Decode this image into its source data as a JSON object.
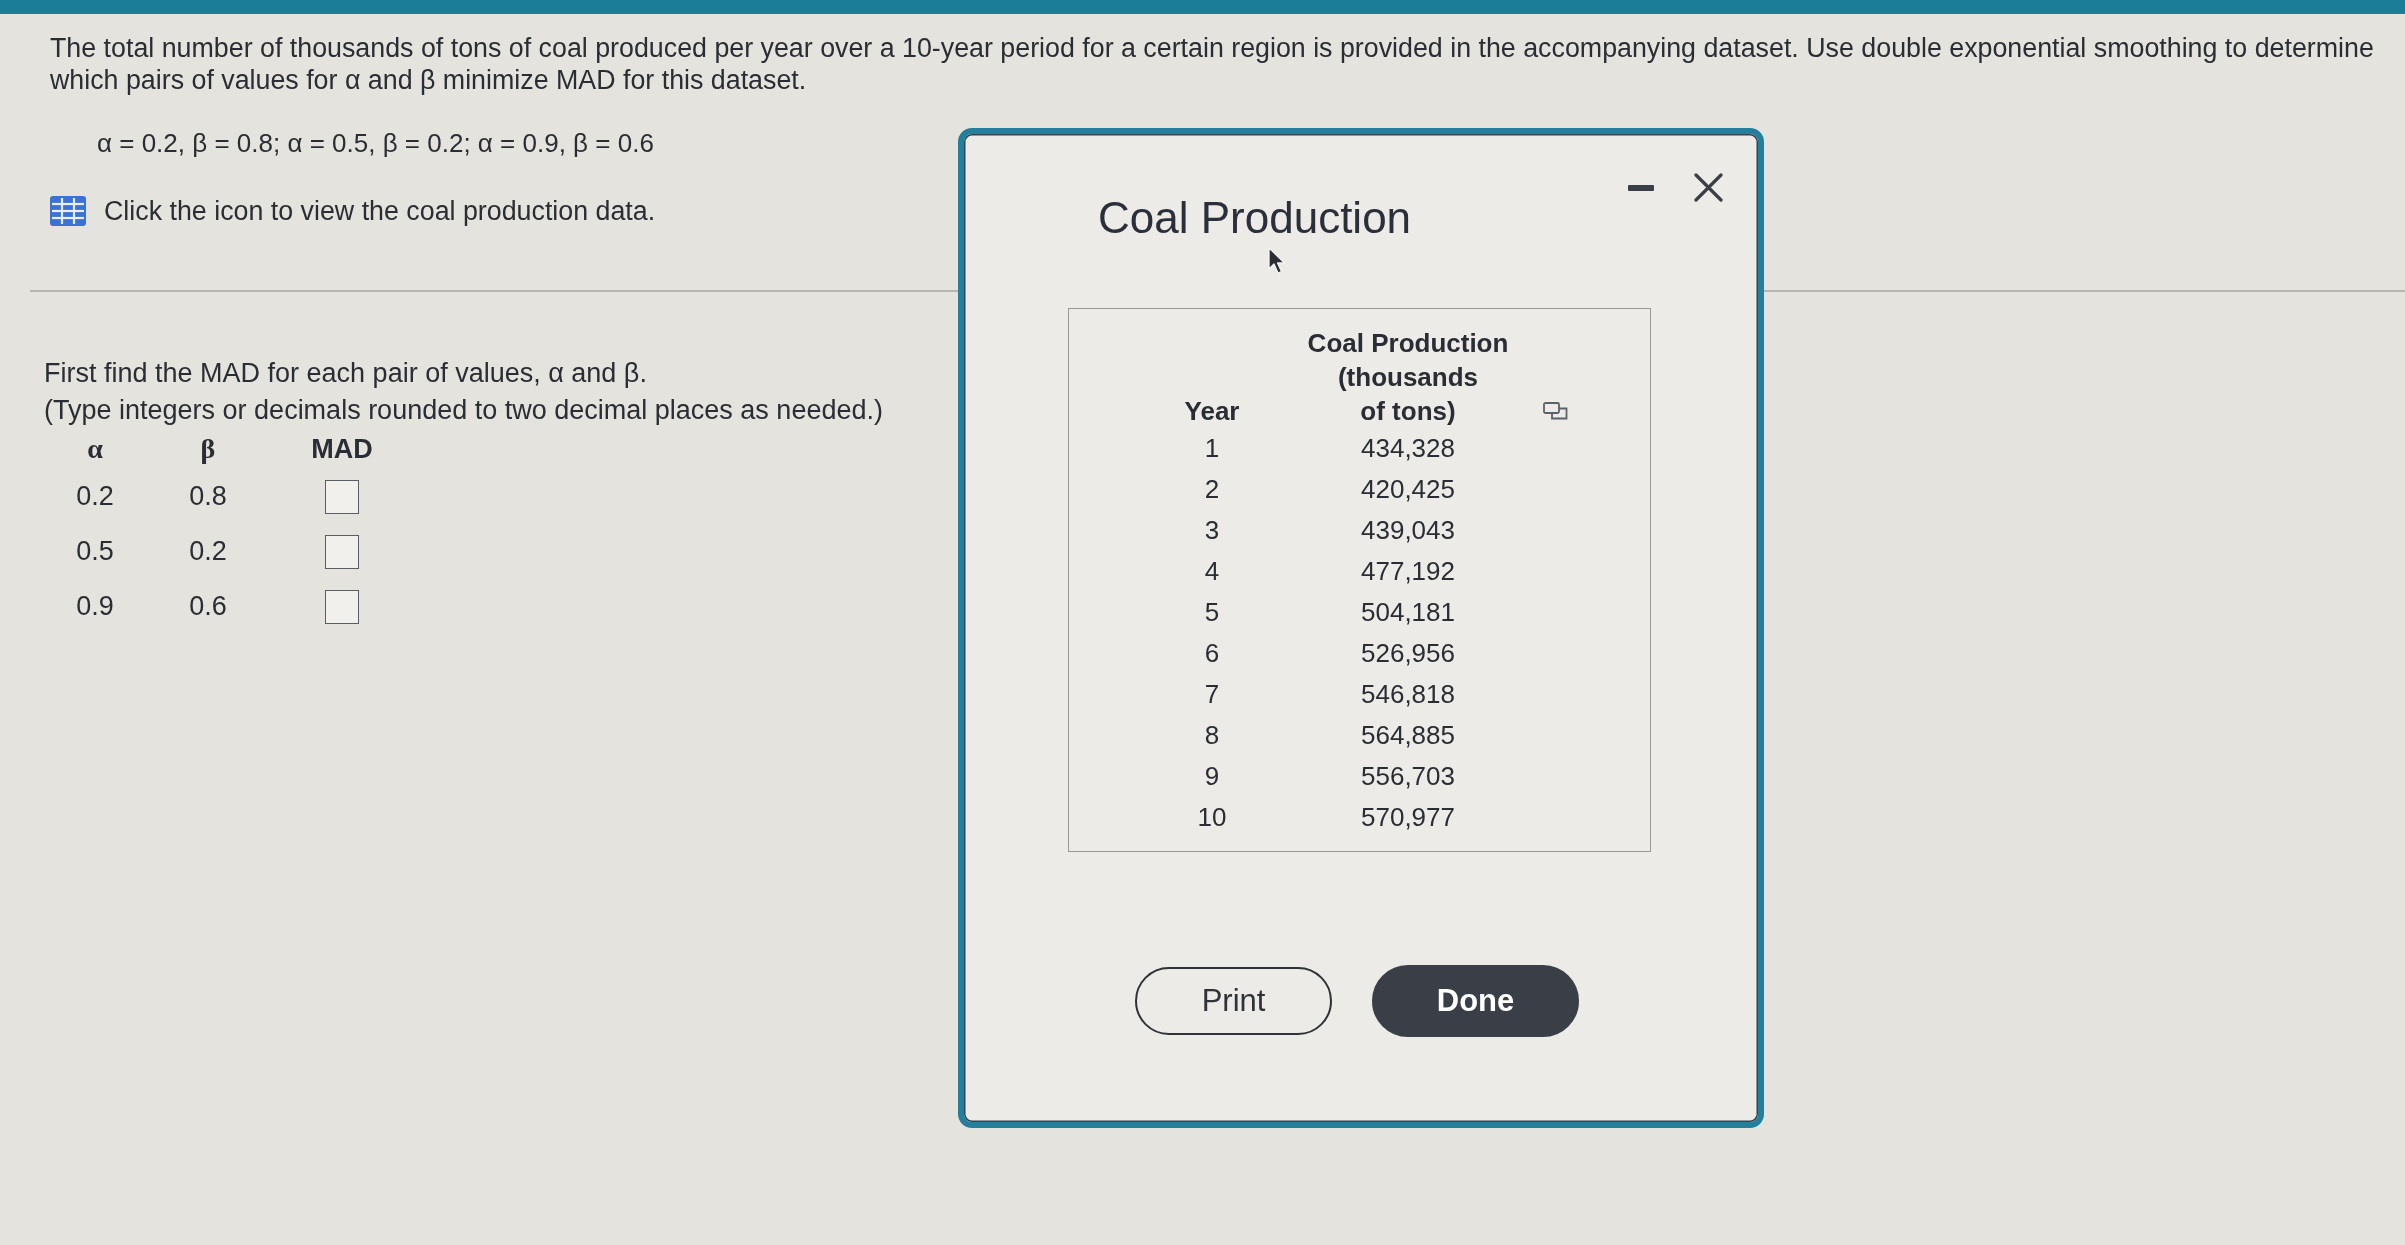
{
  "question": {
    "text": "The total number of thousands of tons of coal produced per year over a 10-year period for a certain region is provided in the accompanying dataset. Use double exponential smoothing to determine which pairs of values for α and β minimize MAD for this dataset.",
    "parameter_pairs": "α = 0.2, β = 0.8; α = 0.5, β = 0.2; α = 0.9, β = 0.6",
    "data_link": "Click the icon to view the coal production data."
  },
  "part": {
    "instruction": "First find the MAD for each pair of values, α and β.",
    "hint": "(Type integers or decimals rounded to two decimal places as needed.)",
    "columns": [
      "α",
      "β",
      "MAD"
    ],
    "rows": [
      {
        "alpha": "0.2",
        "beta": "0.8"
      },
      {
        "alpha": "0.5",
        "beta": "0.2"
      },
      {
        "alpha": "0.9",
        "beta": "0.6"
      }
    ]
  },
  "dialog": {
    "title": "Coal Production",
    "columns": [
      "Year",
      "Coal Production\n(thousands\nof tons)"
    ],
    "rows": [
      {
        "year": "1",
        "production": "434,328"
      },
      {
        "year": "2",
        "production": "420,425"
      },
      {
        "year": "3",
        "production": "439,043"
      },
      {
        "year": "4",
        "production": "477,192"
      },
      {
        "year": "5",
        "production": "504,181"
      },
      {
        "year": "6",
        "production": "526,956"
      },
      {
        "year": "7",
        "production": "546,818"
      },
      {
        "year": "8",
        "production": "564,885"
      },
      {
        "year": "9",
        "production": "556,703"
      },
      {
        "year": "10",
        "production": "570,977"
      }
    ],
    "buttons": [
      {
        "label": "Print",
        "kind": "outline"
      },
      {
        "label": "Done",
        "kind": "filled"
      }
    ]
  }
}
